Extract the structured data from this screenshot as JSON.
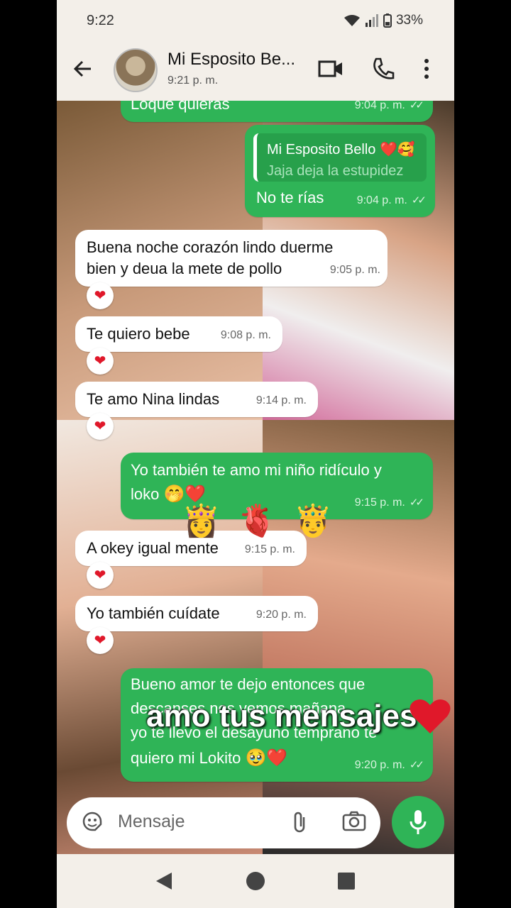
{
  "status_bar": {
    "time": "9:22",
    "battery": "33%"
  },
  "header": {
    "contact_name": "Mi Esposito Be...",
    "last_seen": "9:21 p. m."
  },
  "messages": [
    {
      "text": "Loque quieras",
      "time": "9:04 p. m."
    },
    {
      "reply_to_name": "Mi Esposito Bello ❤️🥰",
      "reply_to_text": "Jaja deja la estupidez",
      "text": "No te rías",
      "time": "9:04 p. m."
    },
    {
      "text_line1": "Buena noche corazón lindo duerme",
      "text_line2": "bien y deua la mete de pollo",
      "time": "9:05 p. m.",
      "reaction": "❤"
    },
    {
      "text": "Te quiero bebe",
      "time": "9:08 p. m.",
      "reaction": "❤"
    },
    {
      "text": "Te amo Nina lindas",
      "time": "9:14 p. m.",
      "reaction": "❤"
    },
    {
      "text_line1": "Yo también te amo mi niño ridículo y",
      "text_line2": "loko",
      "emoji": "🤭❤️",
      "time": "9:15 p. m."
    },
    {
      "text": "A okey igual mente",
      "time": "9:15 p. m.",
      "reaction": "❤"
    },
    {
      "text": "Yo también cuídate",
      "time": "9:20 p. m.",
      "reaction": "❤"
    },
    {
      "text_line1": "Bueno amor te dejo entonces que",
      "text_line2": "descanses nos vemos mañana",
      "text_line3": "yo te llevo el desayuno temprano te",
      "text_line4": "quiero mi Lokito",
      "emoji": "🥹❤️",
      "time": "9:20 p. m."
    }
  ],
  "composer": {
    "placeholder": "Mensaje"
  },
  "overlay": {
    "caption": "amo tus mensajes",
    "stickers": "👸🫀🤴"
  },
  "colors": {
    "outgoing": "#2fb457",
    "incoming": "#ffffff",
    "header_bg": "#f3efe9"
  }
}
